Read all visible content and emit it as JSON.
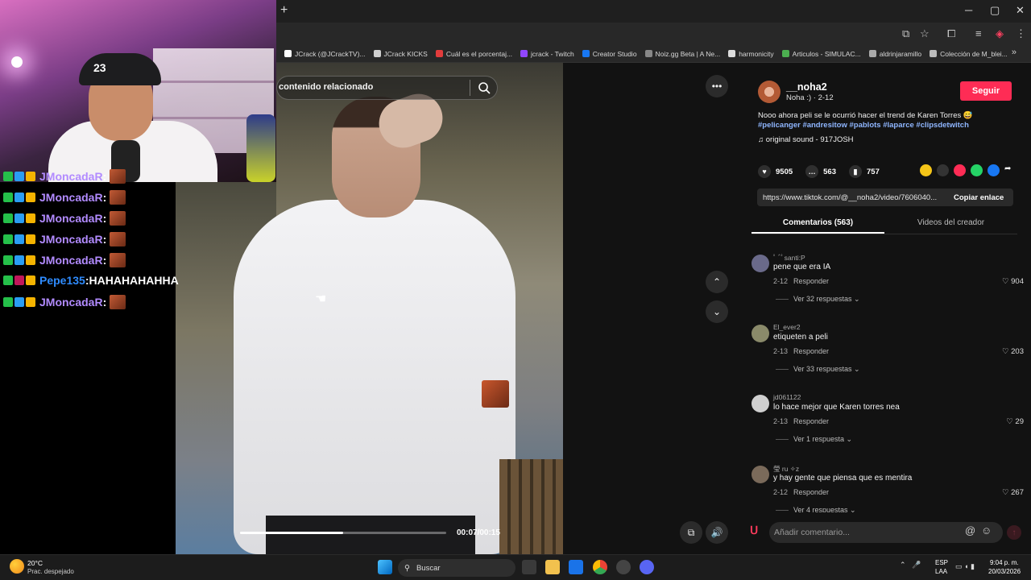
{
  "browser": {
    "new_tab": "+",
    "minimize": "─",
    "maximize": "▢",
    "close": "✕",
    "bookmarks": [
      {
        "label": "JCrack (@JCrackTV)...",
        "color": "#ffffff"
      },
      {
        "label": "JCrack KICKS",
        "color": "#cfcfcf"
      },
      {
        "label": "Cuál es el porcentaj...",
        "color": "#e23c3c"
      },
      {
        "label": "jcrack - Twitch",
        "color": "#9146ff"
      },
      {
        "label": "Creator Studio",
        "color": "#1877f2"
      },
      {
        "label": "Noiz.gg Beta | A Ne...",
        "color": "#888888"
      },
      {
        "label": "harmonicity",
        "color": "#dddddd"
      },
      {
        "label": "Articulos - SIMULAC...",
        "color": "#4caf50"
      },
      {
        "label": "aldrinjaramillo",
        "color": "#aaaaaa"
      },
      {
        "label": "Colección de M_blei...",
        "color": "#bbbbbb"
      }
    ],
    "more": "»"
  },
  "webcam": {
    "cap_number": "23"
  },
  "chat": [
    {
      "user": "JMoncadaR",
      "sep": " :",
      "text": "",
      "color": "#b28bff",
      "emote": true
    },
    {
      "user": "JMoncadaR",
      "sep": " :",
      "text": "",
      "color": "#b28bff",
      "emote": true
    },
    {
      "user": "JMoncadaR",
      "sep": " :",
      "text": "",
      "color": "#b28bff",
      "emote": true
    },
    {
      "user": "JMoncadaR",
      "sep": " :",
      "text": "",
      "color": "#b28bff",
      "emote": true
    },
    {
      "user": "JMoncadaR",
      "sep": " :",
      "text": "",
      "color": "#b28bff",
      "emote": true
    },
    {
      "user": "Pepe135",
      "sep": " :",
      "text": " HAHAHAHAHHA",
      "color": "#2f8cff",
      "emote": false
    },
    {
      "user": "JMoncadaR",
      "sep": " :",
      "text": "",
      "color": "#b28bff",
      "emote": true
    }
  ],
  "video": {
    "search_placeholder": "contenido relacionado",
    "timecode": "00:07/00:15",
    "progress": 0.5,
    "more_icon": "•••",
    "up_icon": "⌃",
    "down_icon": "⌄",
    "volume_icon": "🔊",
    "pip_icon": "⧉"
  },
  "post": {
    "username": "__noha2",
    "subtitle": "Noha :) · 2-12",
    "follow_label": "Seguir",
    "description": "Nooo ahora peli se le ocurrió hacer el trend de Karen Torres 😅",
    "hashtags": "#pelicanger #andresitow #pablots #laparce #clipsdetwitch",
    "sound": "original sound - 917JOSH",
    "likes": "9505",
    "comments_count": "563",
    "saves": "757",
    "link": "https://www.tiktok.com/@__noha2/video/7606040...",
    "copy_link": "Copiar enlace",
    "tab_comments": "Comentarios (563)",
    "tab_videos": "Videos del creador"
  },
  "comments": [
    {
      "name": "ﾟ´ﾟsanti:P",
      "text": "pene que era IA",
      "date": "2-12",
      "reply": "Responder",
      "likes": "904",
      "replies": "Ver 32 respuestas ⌄"
    },
    {
      "name": "El_ever2",
      "text": "etiqueten a peli",
      "date": "2-13",
      "reply": "Responder",
      "likes": "203",
      "replies": "Ver 33 respuestas ⌄"
    },
    {
      "name": "jd061122",
      "text": "lo hace mejor que Karen torres nea",
      "date": "2-13",
      "reply": "Responder",
      "likes": "29",
      "replies": "Ver 1 respuesta ⌄"
    },
    {
      "name": "瑩 ru ✧z",
      "text": "y hay gente que piensa que es mentira",
      "date": "2-12",
      "reply": "Responder",
      "likes": "267",
      "replies": "Ver 4 respuestas ⌄"
    }
  ],
  "comment_input": {
    "placeholder": "Añadir comentario...",
    "at": "@",
    "emoji": "☺",
    "send": "↑"
  },
  "taskbar": {
    "temp": "20°C",
    "weather": "Prac. despejado",
    "search": "Buscar",
    "lang1": "ESP",
    "lang2": "LAA",
    "time": "9:04 p. m.",
    "date": "20/03/2026"
  }
}
